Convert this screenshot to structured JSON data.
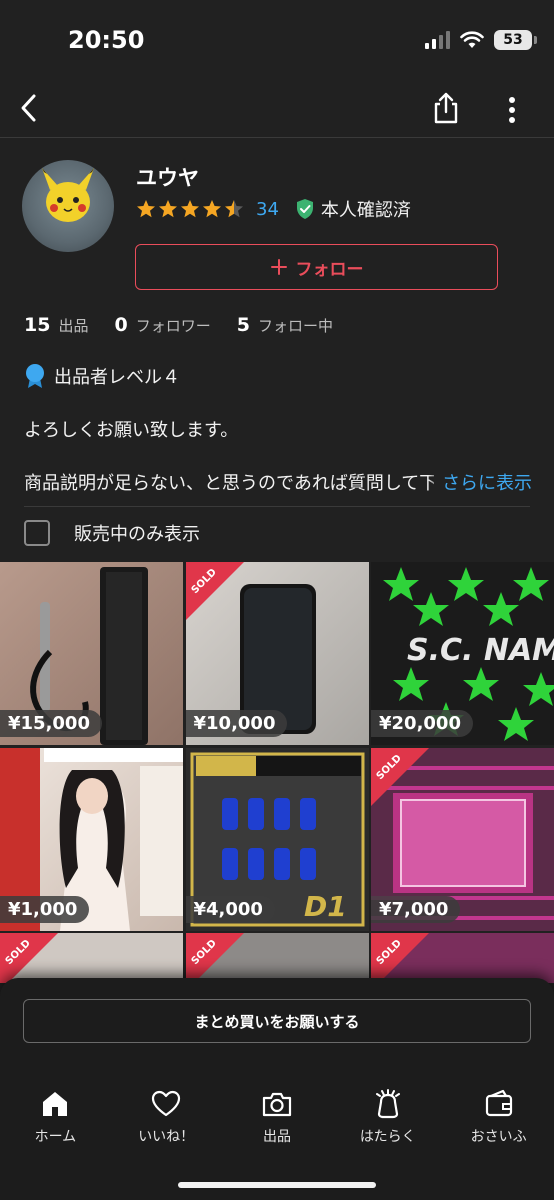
{
  "status": {
    "time": "20:50",
    "battery": "53"
  },
  "profile": {
    "name": "ユウヤ",
    "rating": 4.5,
    "rating_count": "34",
    "verified_label": "本人確認済",
    "follow_label": "フォロー",
    "stats": [
      {
        "value": "15",
        "label": "出品"
      },
      {
        "value": "0",
        "label": "フォロワー"
      },
      {
        "value": "5",
        "label": "フォロー中"
      }
    ],
    "level_label": "出品者レベル４",
    "intro": "よろしくお願い致します。",
    "description": "商品説明が足らない、と思うのであれば質問して下さい",
    "more_label": "さらに表示",
    "filter_label": "販売中のみ表示"
  },
  "items": [
    {
      "price": "¥15,000",
      "sold": false
    },
    {
      "price": "¥10,000",
      "sold": true,
      "sold_label": "SOLD"
    },
    {
      "price": "¥20,000",
      "sold": false
    },
    {
      "price": "¥1,000",
      "sold": false
    },
    {
      "price": "¥4,000",
      "sold": false
    },
    {
      "price": "¥7,000",
      "sold": true,
      "sold_label": "SOLD"
    },
    {
      "sold": true,
      "sold_label": "SOLD"
    },
    {
      "sold": true,
      "sold_label": "SOLD"
    },
    {
      "sold": true,
      "sold_label": "SOLD"
    }
  ],
  "bulk_button_label": "まとめ買いをお願いする",
  "tabs": [
    {
      "label": "ホーム",
      "icon": "home-icon"
    },
    {
      "label": "いいね！",
      "icon": "heart-icon"
    },
    {
      "label": "出品",
      "icon": "camera-icon"
    },
    {
      "label": "はたらく",
      "icon": "work-icon"
    },
    {
      "label": "おさいふ",
      "icon": "wallet-icon"
    }
  ],
  "colors": {
    "accent": "#ea4d5b",
    "link": "#3ea8f0",
    "star": "#f5a623",
    "verified": "#3cb371",
    "sold": "#e0364a"
  }
}
